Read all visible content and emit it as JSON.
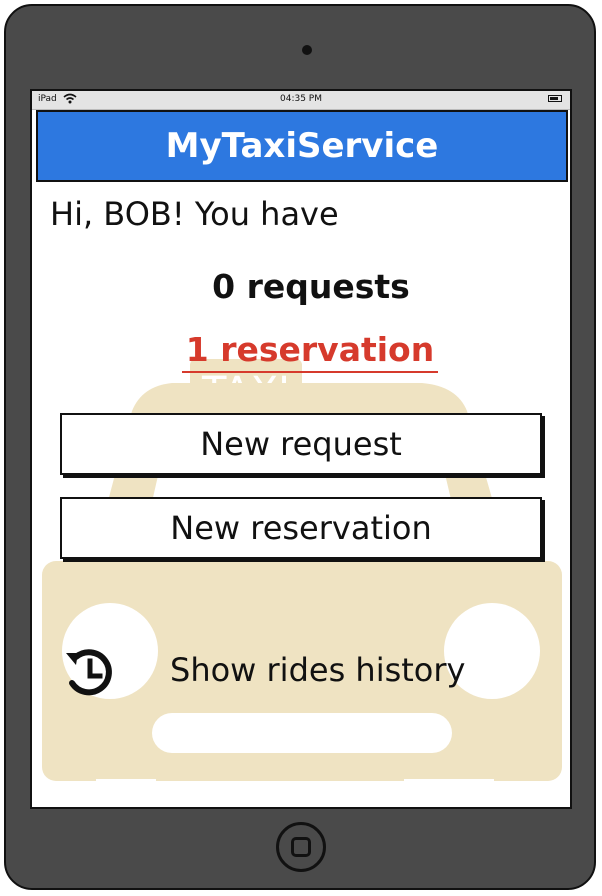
{
  "status_bar": {
    "carrier": "iPad",
    "time": "04:35 PM"
  },
  "header": {
    "title": "MyTaxiService"
  },
  "main": {
    "greeting": "Hi, BOB! You have",
    "requests": "0 requests",
    "reservation": "1 reservation",
    "new_request_label": "New request",
    "new_reservation_label": "New reservation",
    "history_label": "Show rides history"
  },
  "background": {
    "taxi_sign_text": "TAXI"
  },
  "icons": {
    "history": "history-icon",
    "wifi": "wifi-icon",
    "battery": "battery-icon",
    "home": "home-button-icon"
  },
  "colors": {
    "header": "#2d78e0",
    "reservation": "#d63a2c",
    "taxi_watermark": "#efe3c2",
    "device": "#4a4a4a"
  }
}
